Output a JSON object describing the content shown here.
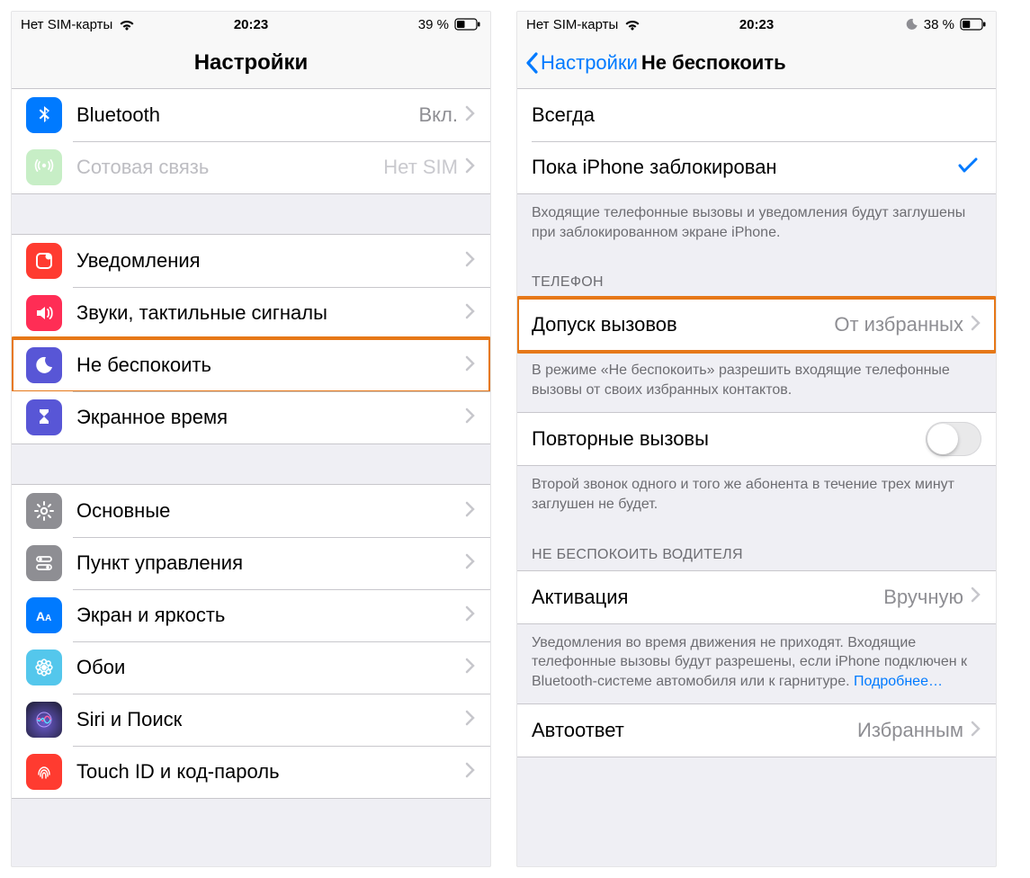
{
  "left": {
    "status": {
      "carrier": "Нет SIM-карты",
      "time": "20:23",
      "battery_pct": "39 %"
    },
    "nav_title": "Настройки",
    "groups": [
      {
        "rows": [
          {
            "id": "bluetooth",
            "icon": "bluetooth-icon",
            "icon_bg": "#007aff",
            "label": "Bluetooth",
            "value": "Вкл.",
            "chevron": true
          },
          {
            "id": "cellular",
            "icon": "antenna-icon",
            "icon_bg": "#76d672",
            "label": "Сотовая связь",
            "value": "Нет SIM",
            "chevron": true,
            "faded": true
          }
        ]
      },
      {
        "rows": [
          {
            "id": "notifications",
            "icon": "notifications-icon",
            "icon_bg": "#ff3b30",
            "label": "Уведомления",
            "chevron": true
          },
          {
            "id": "sounds",
            "icon": "speaker-icon",
            "icon_bg": "#ff2d55",
            "label": "Звуки, тактильные сигналы",
            "chevron": true
          },
          {
            "id": "dnd",
            "icon": "moon-icon",
            "icon_bg": "#5856d6",
            "label": "Не беспокоить",
            "chevron": true,
            "highlight": true
          },
          {
            "id": "screentime",
            "icon": "hourglass-icon",
            "icon_bg": "#5856d6",
            "label": "Экранное время",
            "chevron": true
          }
        ]
      },
      {
        "rows": [
          {
            "id": "general",
            "icon": "gear-icon",
            "icon_bg": "#8e8e93",
            "label": "Основные",
            "chevron": true
          },
          {
            "id": "control-center",
            "icon": "switches-icon",
            "icon_bg": "#8e8e93",
            "label": "Пункт управления",
            "chevron": true
          },
          {
            "id": "display",
            "icon": "text-size-icon",
            "icon_bg": "#007aff",
            "label": "Экран и яркость",
            "chevron": true
          },
          {
            "id": "wallpaper",
            "icon": "flower-icon",
            "icon_bg": "#54c7ec",
            "label": "Обои",
            "chevron": true
          },
          {
            "id": "siri",
            "icon": "siri-icon",
            "icon_bg": "#1c1c1e",
            "label": "Siri и Поиск",
            "chevron": true
          },
          {
            "id": "touchid",
            "icon": "fingerprint-icon",
            "icon_bg": "#ff3b30",
            "label": "Touch ID и код-пароль",
            "chevron": true
          }
        ]
      }
    ]
  },
  "right": {
    "status": {
      "carrier": "Нет SIM-карты",
      "time": "20:23",
      "battery_pct": "38 %",
      "dnd_on": true
    },
    "nav_back": "Настройки",
    "nav_title": "Не беспокоить",
    "silence_group": {
      "rows": [
        {
          "id": "always",
          "label": "Всегда",
          "checked": false
        },
        {
          "id": "while-locked",
          "label": "Пока iPhone заблокирован",
          "checked": true
        }
      ],
      "footer": "Входящие телефонные вызовы и уведомления будут заглушены при заблокированном экране iPhone."
    },
    "phone_group": {
      "header": "ТЕЛЕФОН",
      "row": {
        "id": "allow-calls",
        "label": "Допуск вызовов",
        "value": "От избранных",
        "chevron": true,
        "highlight": true
      },
      "footer": "В режиме «Не беспокоить» разрешить входящие телефонные вызовы от своих избранных контактов."
    },
    "repeat_group": {
      "row": {
        "id": "repeat-calls",
        "label": "Повторные вызовы",
        "toggle": false
      },
      "footer": "Второй звонок одного и того же абонента в течение трех минут заглушен не будет."
    },
    "driving_group": {
      "header": "НЕ БЕСПОКОИТЬ ВОДИТЕЛЯ",
      "row": {
        "id": "activation",
        "label": "Активация",
        "value": "Вручную",
        "chevron": true
      },
      "footer": "Уведомления во время движения не приходят. Входящие телефонные вызовы будут разрешены, если iPhone подключен к Bluetooth-системе автомобиля или к гарнитуре. ",
      "footer_link": "Подробнее…"
    },
    "autoreply_group": {
      "row": {
        "id": "autoreply",
        "label": "Автоответ",
        "value": "Избранным",
        "chevron": true
      }
    }
  }
}
